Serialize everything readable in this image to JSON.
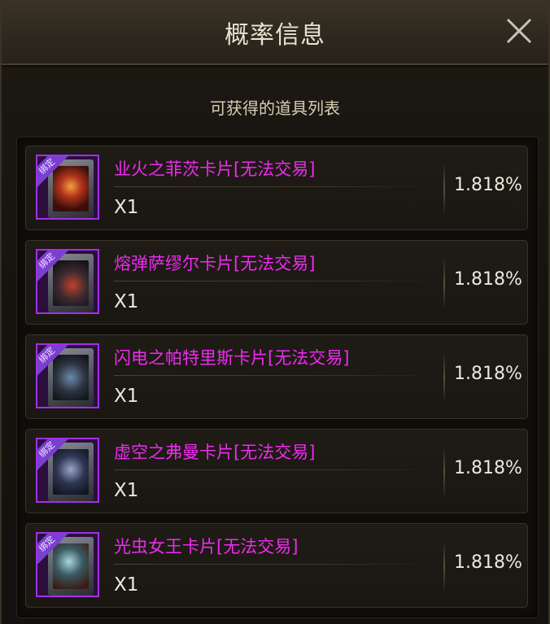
{
  "window": {
    "title": "概率信息",
    "close_icon": "close-x-icon"
  },
  "subtitle": "可获得的道具列表",
  "items": [
    {
      "name": "业火之菲茨卡片[无法交易]",
      "qty": "X1",
      "rate": "1.818%",
      "badge": "绑定",
      "art_color": "#b0331c"
    },
    {
      "name": "熔弹萨缪尔卡片[无法交易]",
      "qty": "X1",
      "rate": "1.818%",
      "badge": "绑定",
      "art_color": "#3a2a30"
    },
    {
      "name": "闪电之帕特里斯卡片[无法交易]",
      "qty": "X1",
      "rate": "1.818%",
      "badge": "绑定",
      "art_color": "#2c3340"
    },
    {
      "name": "虚空之弗曼卡片[无法交易]",
      "qty": "X1",
      "rate": "1.818%",
      "badge": "绑定",
      "art_color": "#2f3652"
    },
    {
      "name": "光虫女王卡片[无法交易]",
      "qty": "X1",
      "rate": "1.818%",
      "badge": "绑定",
      "art_color": "#3b5a64"
    }
  ],
  "colors": {
    "item_name": "#ee2bf0",
    "rarity_border": "#a230e6"
  }
}
